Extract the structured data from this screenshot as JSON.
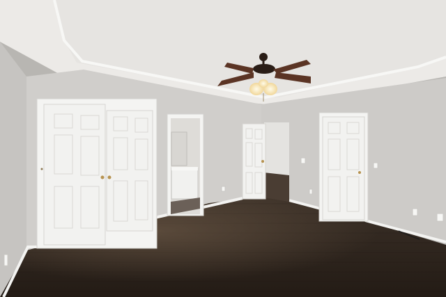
{
  "scene": {
    "colors": {
      "ceiling": "#ecebe9",
      "wall_left": "#c7c5c2",
      "wall_back": "#d1cfcc",
      "wall_right": "#cfcdca",
      "trim": "#f4f4f2",
      "door": "#f3f3f1",
      "floor_dark": "#2d241d",
      "floor_light": "#5a4a3d",
      "brass": "#b6924f",
      "fan_dark": "#2a1d16",
      "fan_blade": "#5b3424",
      "light_glow": "#fff3cf"
    },
    "elements": [
      "ceiling",
      "tray-ceiling-edge",
      "ceiling-fan",
      "closet-double-doors",
      "bathroom-doorway",
      "hallway-door",
      "bedroom-door",
      "wood-floor",
      "baseboards",
      "wall-outlets",
      "light-switches"
    ]
  }
}
